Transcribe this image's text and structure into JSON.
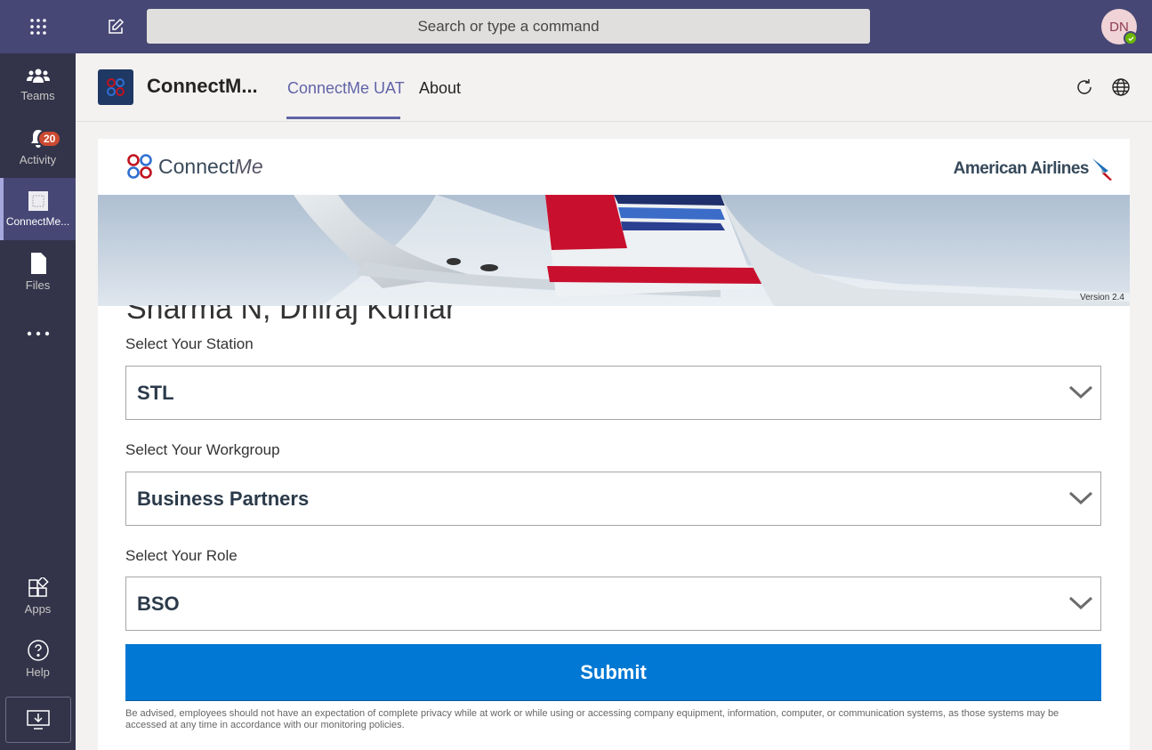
{
  "topbar": {
    "search_placeholder": "Search or type a command",
    "avatar_initials": "DN"
  },
  "rail": {
    "items": [
      {
        "label": "Teams",
        "icon": "teams-icon"
      },
      {
        "label": "Activity",
        "icon": "bell-icon",
        "badge": "20"
      },
      {
        "label": "ConnectMe...",
        "icon": "app-icon"
      },
      {
        "label": "Files",
        "icon": "file-icon"
      },
      {
        "label": "",
        "icon": "more-icon"
      },
      {
        "label": "Apps",
        "icon": "apps-icon"
      },
      {
        "label": "Help",
        "icon": "help-icon"
      }
    ]
  },
  "app": {
    "name": "ConnectM...",
    "tabs": [
      "ConnectMe UAT",
      "About"
    ]
  },
  "card": {
    "logo_text": "Connect",
    "logo_text_italic": "Me",
    "airline": "American Airlines",
    "version": "Version 2.4",
    "user_name": "Sharma N, Dhiraj Kumar",
    "station_label": "Select Your Station",
    "station_value": "STL",
    "workgroup_label": "Select Your Workgroup",
    "workgroup_value": "Business Partners",
    "role_label": "Select Your Role",
    "role_value": "BSO",
    "submit": "Submit",
    "disclaimer": "Be advised, employees should not have an expectation of complete privacy while at work or while using or accessing company equipment, information, computer, or communication systems, as those systems may be accessed at any time in accordance with our monitoring policies."
  }
}
